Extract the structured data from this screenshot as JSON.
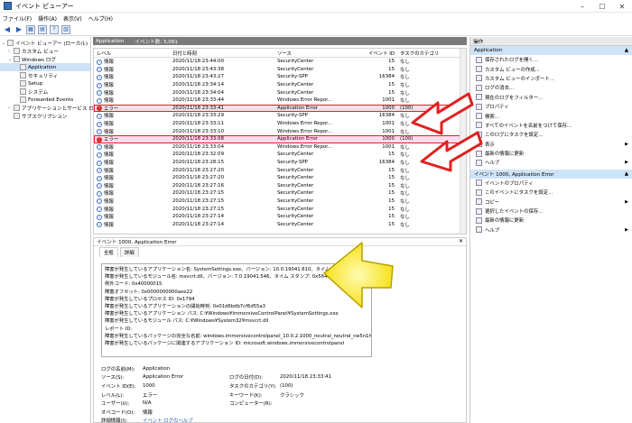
{
  "window": {
    "title": "イベント ビューアー",
    "min": "–",
    "max": "☐",
    "close": "✕"
  },
  "menu": [
    "ファイル(F)",
    "操作(A)",
    "表示(V)",
    "ヘルプ(H)"
  ],
  "tree": [
    {
      "label": "イベント ビューアー (ローカル)",
      "indent": 0,
      "tw": "⌄"
    },
    {
      "label": "カスタム ビュー",
      "indent": 1,
      "tw": "›"
    },
    {
      "label": "Windows ログ",
      "indent": 1,
      "tw": "⌄"
    },
    {
      "label": "Application",
      "indent": 2,
      "tw": "",
      "selected": true
    },
    {
      "label": "セキュリティ",
      "indent": 2,
      "tw": ""
    },
    {
      "label": "Setup",
      "indent": 2,
      "tw": ""
    },
    {
      "label": "システム",
      "indent": 2,
      "tw": ""
    },
    {
      "label": "Forwarded Events",
      "indent": 2,
      "tw": ""
    },
    {
      "label": "アプリケーションとサービス ログ",
      "indent": 1,
      "tw": "›"
    },
    {
      "label": "サブスクリプション",
      "indent": 1,
      "tw": ""
    }
  ],
  "center": {
    "name": "Application",
    "count": "イベント数: 3,091"
  },
  "grid": {
    "headers": [
      "レベル",
      "日付と時刻",
      "ソース",
      "イベント ID",
      "タスクのカテゴリ"
    ],
    "rows": [
      {
        "level": "情報",
        "t": "2020/11/18 23:44:00",
        "src": "SecurityCenter",
        "id": "15",
        "cat": "なし"
      },
      {
        "level": "情報",
        "t": "2020/11/18 23:43:38",
        "src": "SecurityCenter",
        "id": "15",
        "cat": "なし"
      },
      {
        "level": "情報",
        "t": "2020/11/18 23:43:27",
        "src": "Security-SPP",
        "id": "16384",
        "cat": "なし"
      },
      {
        "level": "情報",
        "t": "2020/11/18 23:34:14",
        "src": "SecurityCenter",
        "id": "15",
        "cat": "なし"
      },
      {
        "level": "情報",
        "t": "2020/11/18 23:34:04",
        "src": "SecurityCenter",
        "id": "15",
        "cat": "なし"
      },
      {
        "level": "情報",
        "t": "2020/11/18 23:33:44",
        "src": "Windows Error Repor...",
        "id": "1001",
        "cat": "なし"
      },
      {
        "level": "エラー",
        "t": "2020/11/18 23:33:41",
        "src": "Application Error",
        "id": "1000",
        "cat": "(100)",
        "err": true
      },
      {
        "level": "情報",
        "t": "2020/11/18 23:33:29",
        "src": "Security-SPP",
        "id": "16384",
        "cat": "なし"
      },
      {
        "level": "情報",
        "t": "2020/11/18 23:33:11",
        "src": "Windows Error Repor...",
        "id": "1001",
        "cat": "なし"
      },
      {
        "level": "情報",
        "t": "2020/11/18 23:33:10",
        "src": "Windows Error Repor...",
        "id": "1001",
        "cat": "なし"
      },
      {
        "level": "エラー",
        "t": "2020/11/18 23:33:08",
        "src": "Application Error",
        "id": "1000",
        "cat": "(100)",
        "err": true
      },
      {
        "level": "情報",
        "t": "2020/11/18 23:33:04",
        "src": "Windows Error Repor...",
        "id": "1001",
        "cat": "なし"
      },
      {
        "level": "情報",
        "t": "2020/11/18 23:32:09",
        "src": "SecurityCenter",
        "id": "15",
        "cat": "なし"
      },
      {
        "level": "情報",
        "t": "2020/11/18 23:28:15",
        "src": "Security-SPP",
        "id": "16384",
        "cat": "なし"
      },
      {
        "level": "情報",
        "t": "2020/11/18 23:27:20",
        "src": "SecurityCenter",
        "id": "15",
        "cat": "なし"
      },
      {
        "level": "情報",
        "t": "2020/11/18 23:27:20",
        "src": "SecurityCenter",
        "id": "15",
        "cat": "なし"
      },
      {
        "level": "情報",
        "t": "2020/11/18 23:27:16",
        "src": "SecurityCenter",
        "id": "15",
        "cat": "なし"
      },
      {
        "level": "情報",
        "t": "2020/11/18 23:27:15",
        "src": "SecurityCenter",
        "id": "15",
        "cat": "なし"
      },
      {
        "level": "情報",
        "t": "2020/11/18 23:27:15",
        "src": "SecurityCenter",
        "id": "15",
        "cat": "なし"
      },
      {
        "level": "情報",
        "t": "2020/11/18 23:27:15",
        "src": "SecurityCenter",
        "id": "15",
        "cat": "なし"
      },
      {
        "level": "情報",
        "t": "2020/11/18 23:27:14",
        "src": "SecurityCenter",
        "id": "15",
        "cat": "なし"
      },
      {
        "level": "情報",
        "t": "2020/11/18 23:27:14",
        "src": "SecurityCenter",
        "id": "15",
        "cat": "なし"
      }
    ]
  },
  "detail": {
    "header": "イベント 1000, Application Error",
    "tabs": [
      "全般",
      "詳細"
    ],
    "desc": [
      "障害が発生しているアプリケーション名: SystemSettings.exe、バージョン: 10.0.19041.610、タイム スタンプ: 0x67096573",
      "障害が発生しているモジュール名: msvcrt.dll、バージョン: 7.0.19041.546、タイム スタンプ: 0x56419f39",
      "例外コード: 0x40000015",
      "障害オフセット: 0x0000000000aee22",
      "障害が発生しているプロセス ID: 0x1794",
      "障害が発生しているアプリケーションの開始時刻: 0x01d6bdb7cf6d55a3",
      "障害が発生しているアプリケーション パス: C:¥Windows¥ImmersiveControlPanel¥SystemSettings.exe",
      "障害が発生しているモジュール パス: C:¥Windows¥System32¥msvcrt.dll",
      "レポート ID:",
      "障害が発生しているパッケージの完全な名前: windows.immersivecontrolpanel_10.0.2.1000_neutral_neutral_cw5n1h2txyewy",
      "障害が発生しているパッケージに関連するアプリケーション ID: microsoft.windows.immersivecontrolpanel"
    ],
    "props": [
      [
        "ログの名前(M):",
        "Application",
        "",
        ""
      ],
      [
        "ソース(S):",
        "Application Error",
        "ログの日付(D):",
        "2020/11/18 23:33:41"
      ],
      [
        "イベント ID(E):",
        "1000",
        "タスクのカテゴリ(Y):",
        "(100)"
      ],
      [
        "レベル(L):",
        "エラー",
        "キーワード(K):",
        "クラシック"
      ],
      [
        "ユーザー(U):",
        "N/A",
        "コンピューター(R):",
        ""
      ],
      [
        "オペコード(O):",
        "情報",
        "",
        ""
      ],
      [
        "詳細情報(I):",
        "イベント ログのヘルプ",
        "",
        ""
      ]
    ]
  },
  "actions": {
    "header": "操作",
    "sub1": "Application",
    "items1": [
      {
        "label": "保存されたログを開く..."
      },
      {
        "label": "カスタム ビューの作成..."
      },
      {
        "label": "カスタム ビューのインポート..."
      },
      {
        "label": "ログの消去..."
      },
      {
        "label": "現在のログをフィルター..."
      },
      {
        "label": "プロパティ"
      },
      {
        "label": "検索..."
      },
      {
        "label": "すべてのイベントを名前をつけて保存..."
      },
      {
        "label": "このログにタスクを設定..."
      },
      {
        "label": "表示",
        "sub": true
      },
      {
        "label": "最新の情報に更新"
      },
      {
        "label": "ヘルプ",
        "sub": true
      }
    ],
    "sub2": "イベント 1000, Application Error",
    "items2": [
      {
        "label": "イベントのプロパティ"
      },
      {
        "label": "このイベントにタスクを設定..."
      },
      {
        "label": "コピー",
        "sub": true
      },
      {
        "label": "選択したイベントの保存..."
      },
      {
        "label": "最新の情報に更新"
      },
      {
        "label": "ヘルプ",
        "sub": true
      }
    ]
  },
  "colors": {
    "error": "#d22222",
    "highlight": "#e02020",
    "arrow": "#ffe600"
  }
}
